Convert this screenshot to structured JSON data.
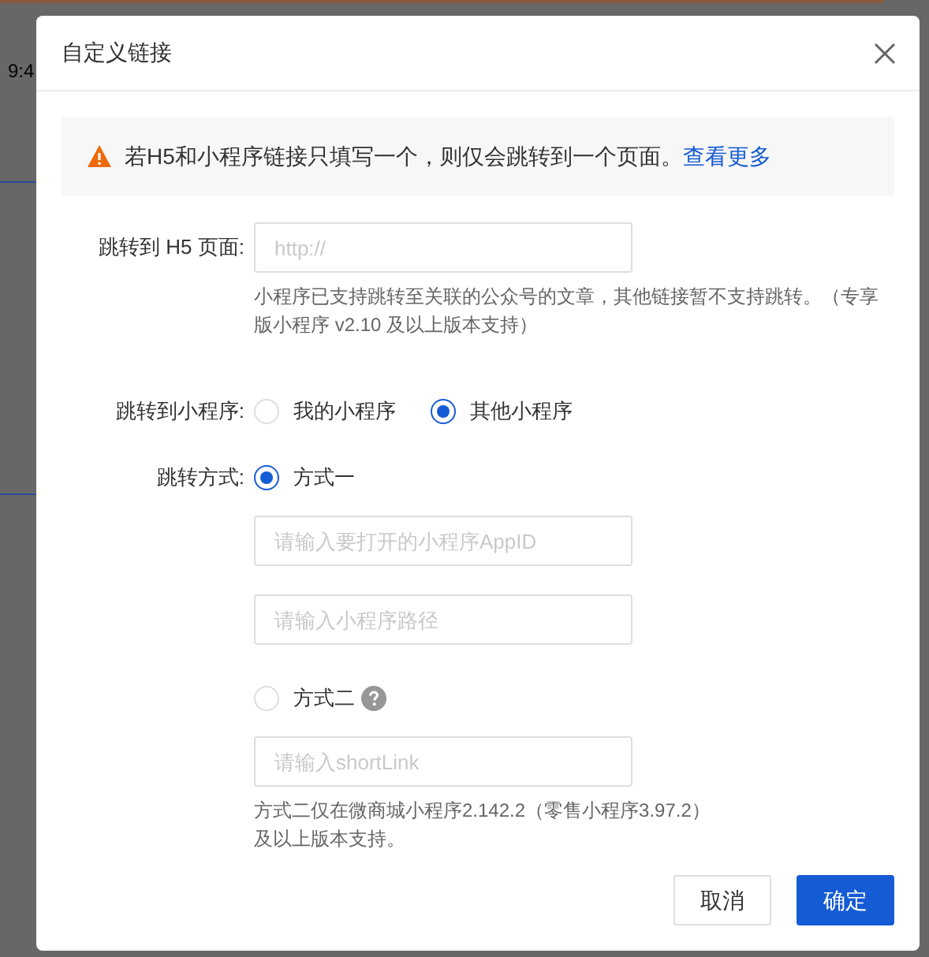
{
  "backdrop": {
    "time": "9:4"
  },
  "dialog": {
    "title": "自定义链接"
  },
  "notice": {
    "text": "若H5和小程序链接只填写一个，则仅会跳转到一个页面。",
    "link": "查看更多"
  },
  "h5": {
    "label": "跳转到 H5 页面:",
    "placeholder": "http://",
    "hint": "小程序已支持跳转至关联的公众号的文章，其他链接暂不支持跳转。（专享版小程序 v2.10 及以上版本支持）"
  },
  "mini_program": {
    "label": "跳转到小程序:",
    "options": [
      {
        "label": "我的小程序",
        "selected": false
      },
      {
        "label": "其他小程序",
        "selected": true
      }
    ]
  },
  "method": {
    "label": "跳转方式:",
    "options": [
      {
        "label": "方式一",
        "selected": true,
        "help": false,
        "fields": [
          {
            "placeholder": "请输入要打开的小程序AppID"
          },
          {
            "placeholder": "请输入小程序路径"
          }
        ]
      },
      {
        "label": "方式二",
        "selected": false,
        "help": true,
        "fields": [
          {
            "placeholder": "请输入shortLink"
          }
        ],
        "hint": "方式二仅在微商城小程序2.142.2（零售小程序3.97.2）及以上版本支持。"
      }
    ]
  },
  "buttons": [
    {
      "label": "取消",
      "primary": false
    },
    {
      "label": "确定",
      "primary": true
    }
  ]
}
